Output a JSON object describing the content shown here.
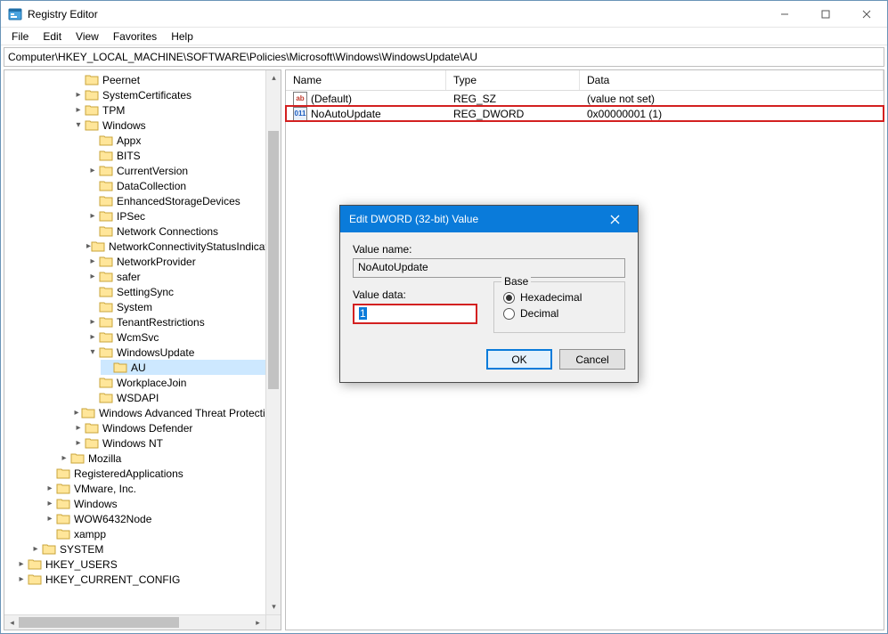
{
  "window": {
    "title": "Registry Editor"
  },
  "menu": {
    "file": "File",
    "edit": "Edit",
    "view": "View",
    "favorites": "Favorites",
    "help": "Help"
  },
  "address": "Computer\\HKEY_LOCAL_MACHINE\\SOFTWARE\\Policies\\Microsoft\\Windows\\WindowsUpdate\\AU",
  "columns": {
    "name": "Name",
    "type": "Type",
    "data": "Data"
  },
  "values": [
    {
      "icon": "sz",
      "name": "(Default)",
      "type": "REG_SZ",
      "data": "(value not set)",
      "highlight": false
    },
    {
      "icon": "dw",
      "name": "NoAutoUpdate",
      "type": "REG_DWORD",
      "data": "0x00000001 (1)",
      "highlight": true
    }
  ],
  "dialog": {
    "title": "Edit DWORD (32-bit) Value",
    "value_name_label": "Value name:",
    "value_name": "NoAutoUpdate",
    "value_data_label": "Value data:",
    "value_data": "1",
    "base_label": "Base",
    "hex_label": "Hexadecimal",
    "dec_label": "Decimal",
    "ok": "OK",
    "cancel": "Cancel"
  },
  "tree": {
    "peernet": "Peernet",
    "systemcertificates": "SystemCertificates",
    "tpm": "TPM",
    "windows": "Windows",
    "appx": "Appx",
    "bits": "BITS",
    "currentversion": "CurrentVersion",
    "datacollection": "DataCollection",
    "enhancedstoragedevices": "EnhancedStorageDevices",
    "ipsec": "IPSec",
    "networkconnections": "Network Connections",
    "ncsi": "NetworkConnectivityStatusIndicator",
    "networkprovider": "NetworkProvider",
    "safer": "safer",
    "settingsync": "SettingSync",
    "system": "System",
    "tenantrestrictions": "TenantRestrictions",
    "wcmsvc": "WcmSvc",
    "windowsupdate": "WindowsUpdate",
    "au": "AU",
    "workplacejoin": "WorkplaceJoin",
    "wsdapi": "WSDAPI",
    "watp": "Windows Advanced Threat Protection",
    "windefender": "Windows Defender",
    "winnt": "Windows NT",
    "mozilla": "Mozilla",
    "regapps": "RegisteredApplications",
    "vmware": "VMware, Inc.",
    "windows2": "Windows",
    "wow64": "WOW6432Node",
    "xampp": "xampp",
    "system_hive": "SYSTEM",
    "hku": "HKEY_USERS",
    "hkcc": "HKEY_CURRENT_CONFIG"
  }
}
